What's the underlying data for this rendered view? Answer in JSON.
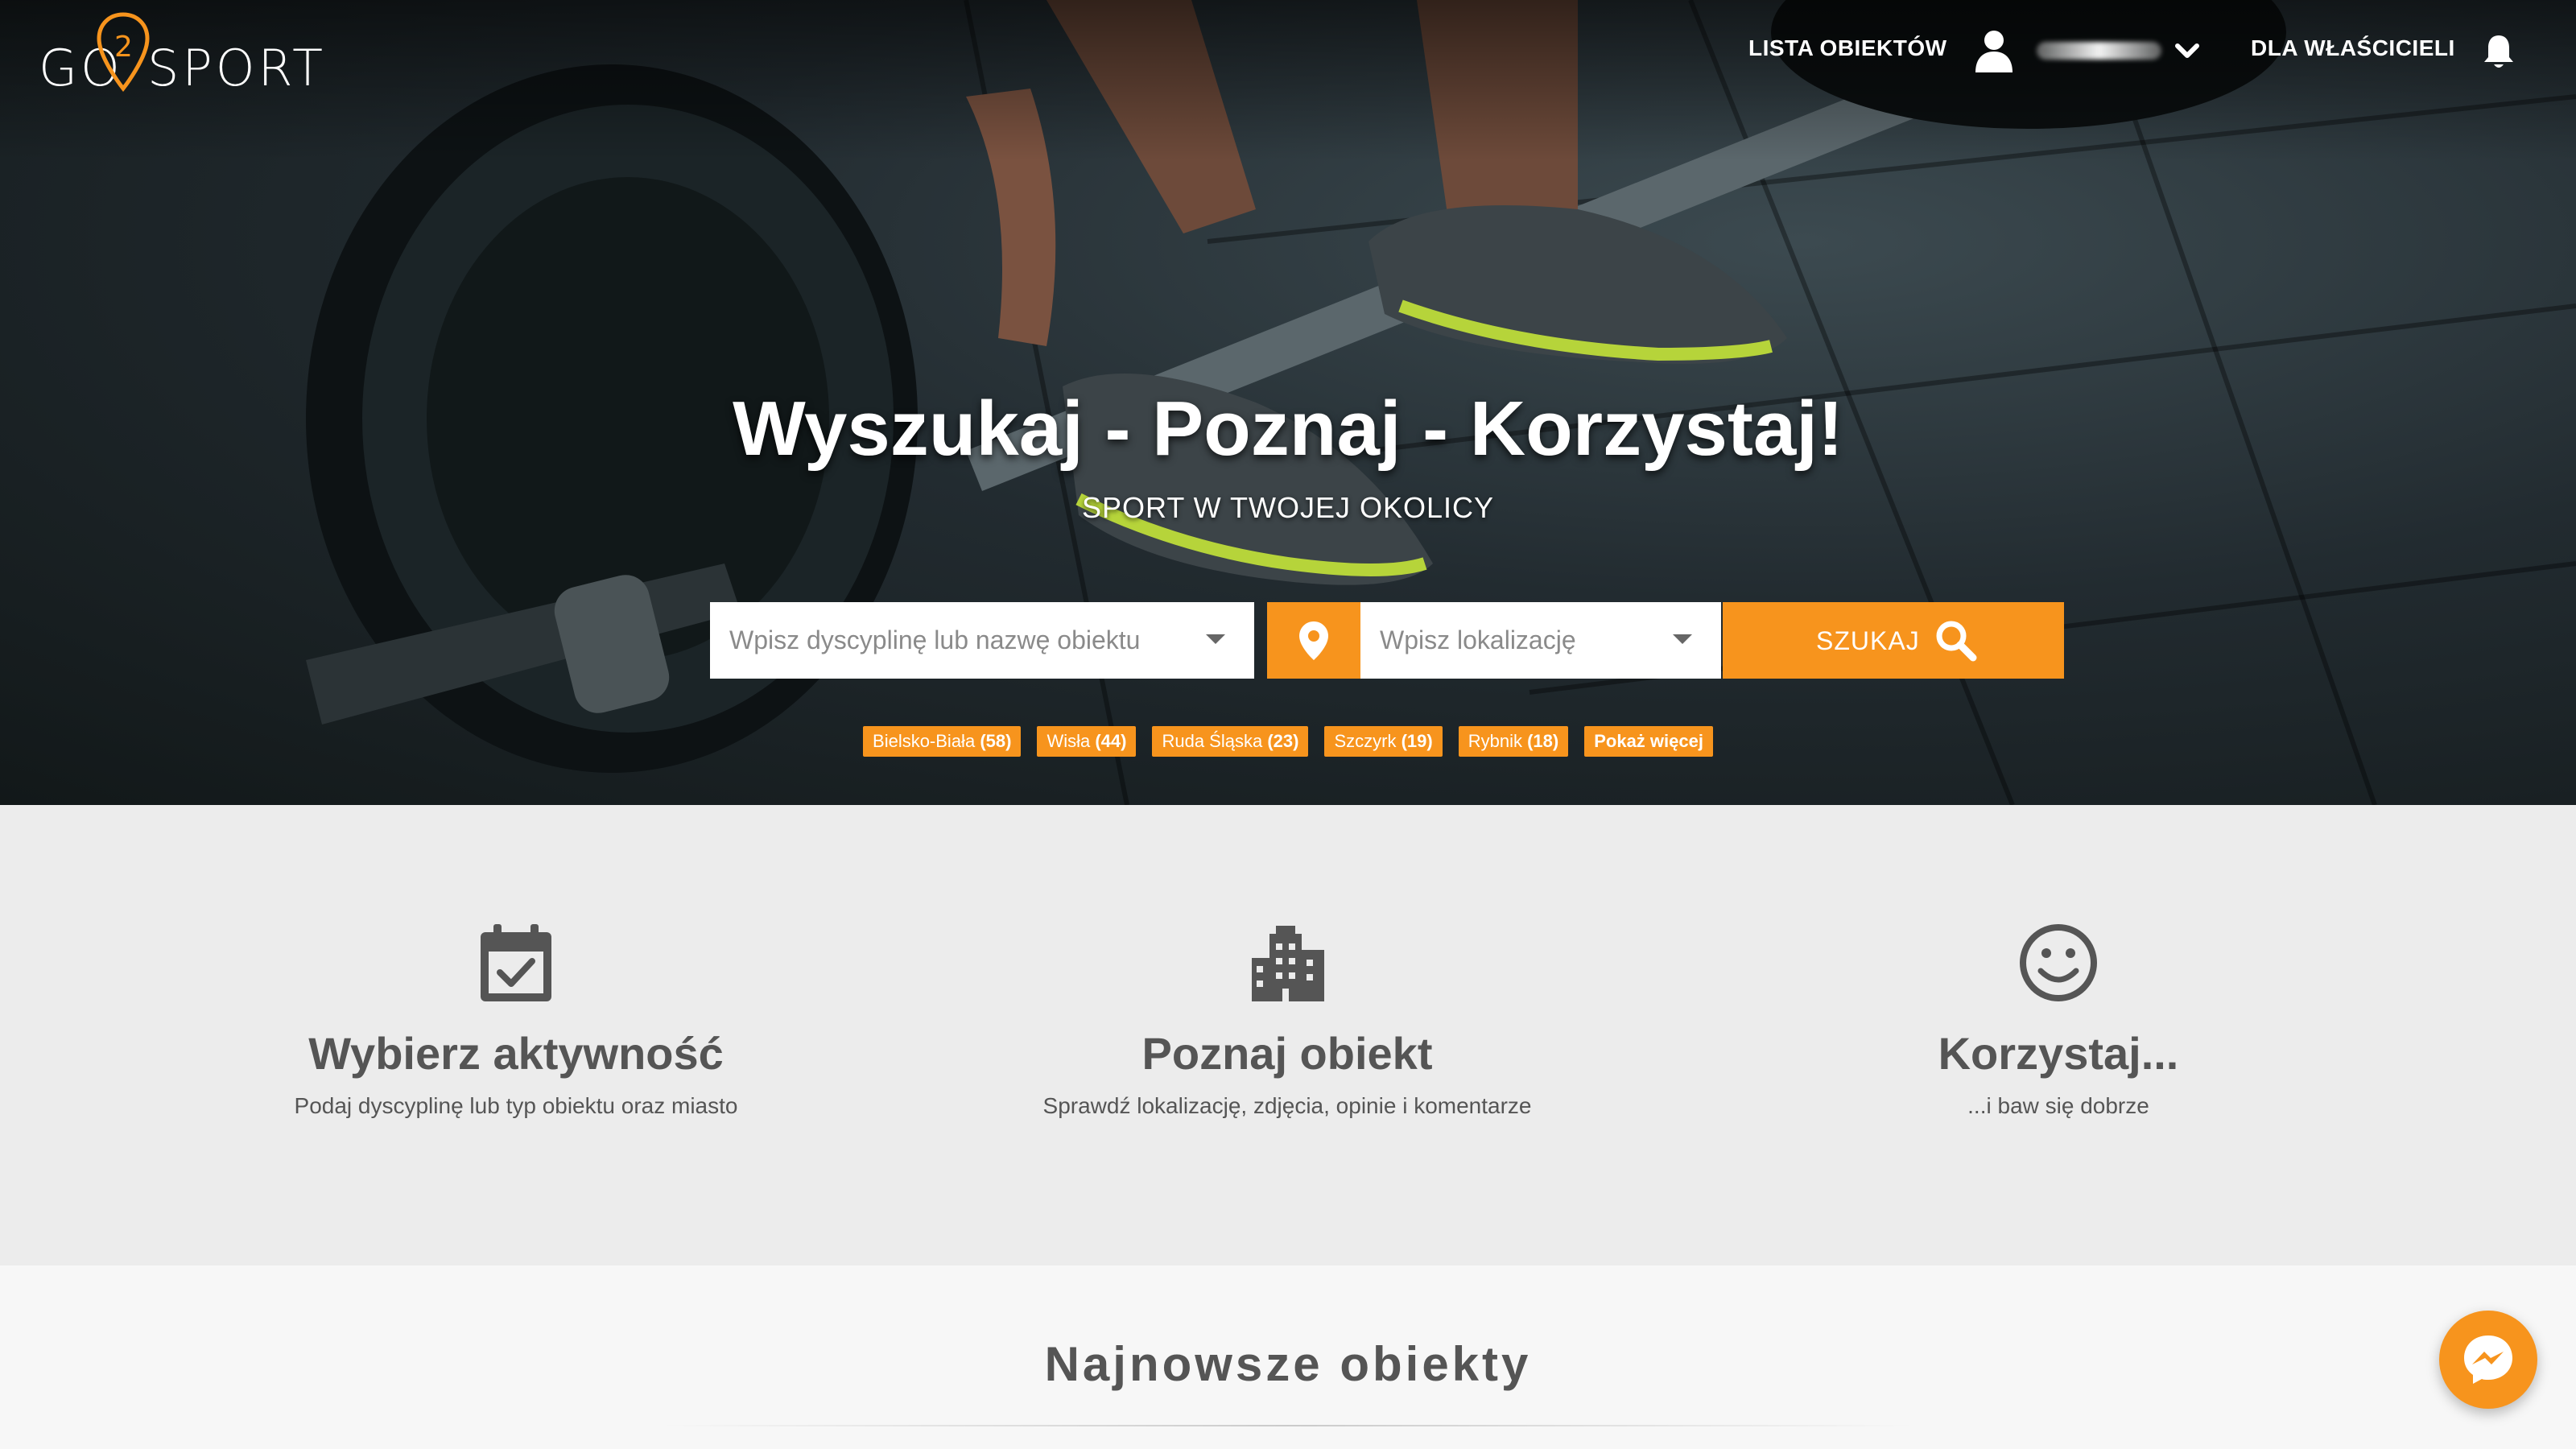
{
  "brand": {
    "logo_left": "GO",
    "logo_digit": "2",
    "logo_right": "SPORT",
    "accent_color": "#f7941d"
  },
  "nav": {
    "items_link": "LISTA OBIEKTÓW",
    "owners_link": "DLA WŁAŚCICIELI",
    "user_icon": "user-icon",
    "dropdown_icon": "chevron-down-icon",
    "notification_icon": "bell-icon"
  },
  "hero": {
    "headline": "Wyszukaj - Poznaj - Korzystaj!",
    "subheadline": "SPORT W TWOJEJ OKOLICY"
  },
  "search": {
    "discipline_placeholder": "Wpisz dyscyplinę lub nazwę obiektu",
    "discipline_value": "",
    "location_placeholder": "Wpisz lokalizację",
    "location_value": "",
    "location_icon": "map-pin-icon",
    "button_label": "SZUKAJ",
    "button_icon": "search-icon"
  },
  "city_tags": [
    {
      "name": "Bielsko-Biała",
      "count": "(58)"
    },
    {
      "name": "Wisła",
      "count": "(44)"
    },
    {
      "name": "Ruda Śląska",
      "count": "(23)"
    },
    {
      "name": "Szczyrk",
      "count": "(19)"
    },
    {
      "name": "Rybnik",
      "count": "(18)"
    }
  ],
  "show_more_label": "Pokaż więcej",
  "steps": [
    {
      "icon": "calendar-check-icon",
      "title": "Wybierz aktywność",
      "text": "Podaj dyscyplinę lub typ obiektu oraz miasto"
    },
    {
      "icon": "building-icon",
      "title": "Poznaj obiekt",
      "text": "Sprawdź lokalizację, zdjęcia, opinie i komentarze"
    },
    {
      "icon": "smiley-icon",
      "title": "Korzystaj...",
      "text": "...i baw się dobrze"
    }
  ],
  "newest": {
    "title": "Najnowsze obiekty"
  },
  "chat": {
    "icon": "messenger-icon"
  }
}
